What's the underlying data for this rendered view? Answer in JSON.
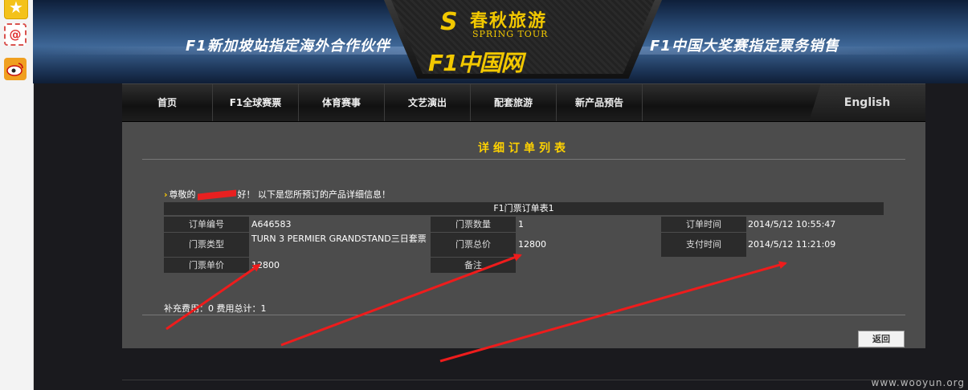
{
  "share": {
    "icons": [
      "favorite-star-icon",
      "email-at-icon",
      "weibo-icon"
    ]
  },
  "banner": {
    "slogan_left": "F1新加坡站指定海外合作伙伴",
    "slogan_right": "F1中国大奖赛指定票务销售",
    "brand_cn": "春秋旅游",
    "brand_en": "SPRING TOUR",
    "site_name": "F1中国网"
  },
  "nav": {
    "items": [
      "首页",
      "F1全球赛票",
      "体育赛事",
      "文艺演出",
      "配套旅游",
      "新产品预告"
    ],
    "english": "English"
  },
  "order": {
    "page_title": "详细订单列表",
    "greeting_prefix": "尊敬的",
    "greeting_suffix": "好！ 以下是您所预订的产品详细信息！",
    "table_title": "F1门票订单表1",
    "labels": {
      "order_no": "订单编号",
      "ticket_type": "门票类型",
      "unit_price": "门票单价",
      "quantity": "门票数量",
      "total": "门票总价",
      "remark": "备注",
      "order_time": "订单时间",
      "pay_time": "支付时间"
    },
    "values": {
      "order_no": "A646583",
      "ticket_type": "TURN 3 PERMIER GRANDSTAND三日套票",
      "unit_price": "12800",
      "quantity": "1",
      "total": "12800",
      "remark": "",
      "order_time": "2014/5/12 10:55:47",
      "pay_time": "2014/5/12 11:21:09"
    },
    "extra_fees": "补充费用：0  费用总计：1",
    "back_label": "返回"
  },
  "footer": {
    "watermark": "www.wooyun.org"
  },
  "colors": {
    "accent_yellow": "#ffd200",
    "annotation_red": "#ee1c1c",
    "panel_bg": "#4c4c4c"
  }
}
